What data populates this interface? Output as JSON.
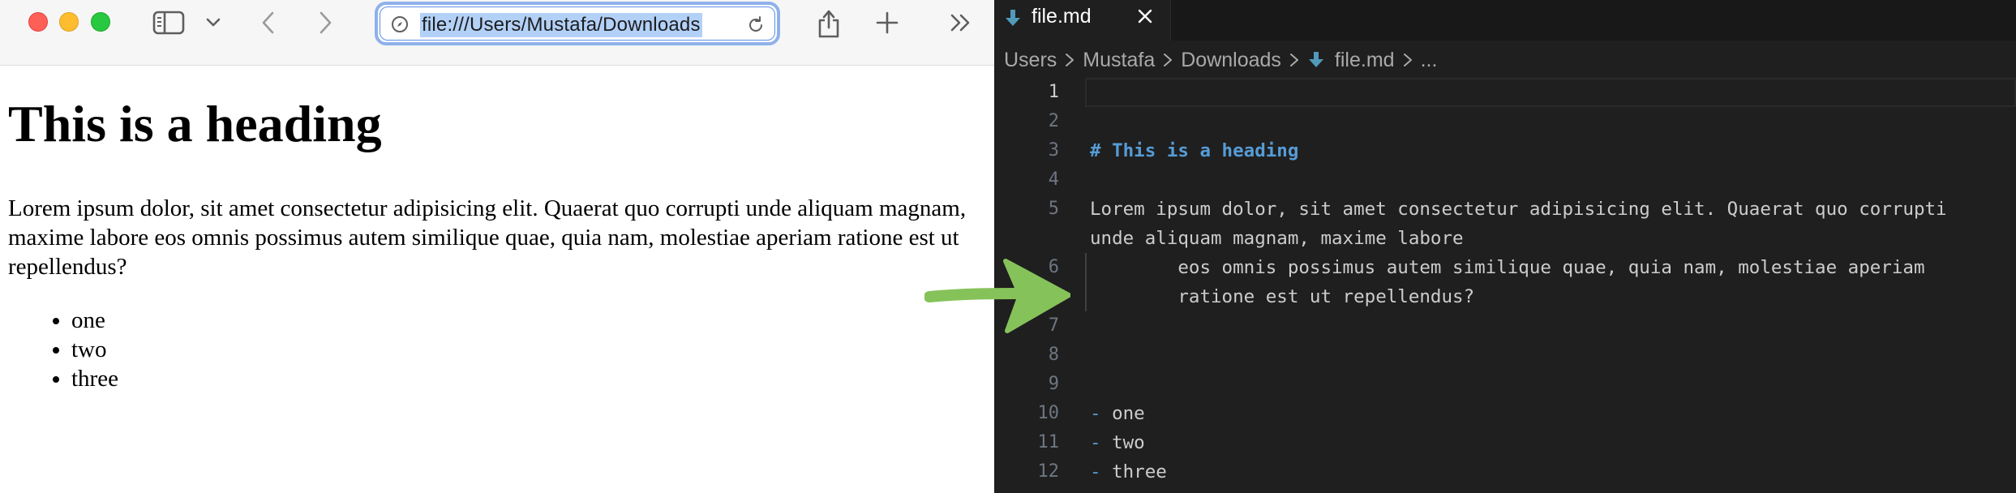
{
  "browser": {
    "address_url": "file:///Users/Mustafa/Downloads",
    "heading": "This is a heading",
    "paragraph": "Lorem ipsum dolor, sit amet consectetur adipisicing elit. Quaerat quo corrupti unde aliquam magnam, maxime labore eos omnis possimus autem similique quae, quia nam, molestiae aperiam ratione est ut repellendus?",
    "list_items": [
      "one",
      "two",
      "three"
    ]
  },
  "editor": {
    "tab_label": "file.md",
    "breadcrumb": {
      "parts": [
        "Users",
        "Mustafa",
        "Downloads"
      ],
      "file": "file.md",
      "ellipsis": "..."
    },
    "line_numbers": [
      "1",
      "2",
      "3",
      "4",
      "5",
      "6",
      "7",
      "8",
      "9",
      "10",
      "11",
      "12"
    ],
    "code": {
      "heading": "# This is a heading",
      "para_line_1": "Lorem ipsum dolor, sit amet consectetur adipisicing elit. Quaerat quo corrupti",
      "para_line_2": "unde aliquam magnam, maxime labore",
      "para_line_3": "        eos omnis possimus autem similique quae, quia nam, molestiae aperiam",
      "para_line_4": "        ratione est ut repellendus?",
      "bullet_marker": "-",
      "bullets": [
        "one",
        "two",
        "three"
      ]
    }
  },
  "colors": {
    "editor_bg": "#1f1f1f",
    "heading_blue": "#569cd6",
    "arrow_green": "#86c25a",
    "address_focus": "#8fb1ea"
  }
}
